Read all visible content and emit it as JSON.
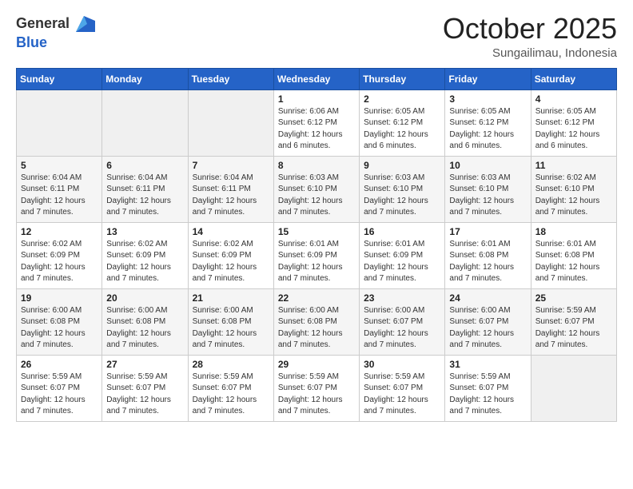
{
  "header": {
    "logo_general": "General",
    "logo_blue": "Blue",
    "month": "October 2025",
    "location": "Sungailimau, Indonesia"
  },
  "days_of_week": [
    "Sunday",
    "Monday",
    "Tuesday",
    "Wednesday",
    "Thursday",
    "Friday",
    "Saturday"
  ],
  "weeks": [
    [
      {
        "day": "",
        "detail": ""
      },
      {
        "day": "",
        "detail": ""
      },
      {
        "day": "",
        "detail": ""
      },
      {
        "day": "1",
        "detail": "Sunrise: 6:06 AM\nSunset: 6:12 PM\nDaylight: 12 hours\nand 6 minutes."
      },
      {
        "day": "2",
        "detail": "Sunrise: 6:05 AM\nSunset: 6:12 PM\nDaylight: 12 hours\nand 6 minutes."
      },
      {
        "day": "3",
        "detail": "Sunrise: 6:05 AM\nSunset: 6:12 PM\nDaylight: 12 hours\nand 6 minutes."
      },
      {
        "day": "4",
        "detail": "Sunrise: 6:05 AM\nSunset: 6:12 PM\nDaylight: 12 hours\nand 6 minutes."
      }
    ],
    [
      {
        "day": "5",
        "detail": "Sunrise: 6:04 AM\nSunset: 6:11 PM\nDaylight: 12 hours\nand 7 minutes."
      },
      {
        "day": "6",
        "detail": "Sunrise: 6:04 AM\nSunset: 6:11 PM\nDaylight: 12 hours\nand 7 minutes."
      },
      {
        "day": "7",
        "detail": "Sunrise: 6:04 AM\nSunset: 6:11 PM\nDaylight: 12 hours\nand 7 minutes."
      },
      {
        "day": "8",
        "detail": "Sunrise: 6:03 AM\nSunset: 6:10 PM\nDaylight: 12 hours\nand 7 minutes."
      },
      {
        "day": "9",
        "detail": "Sunrise: 6:03 AM\nSunset: 6:10 PM\nDaylight: 12 hours\nand 7 minutes."
      },
      {
        "day": "10",
        "detail": "Sunrise: 6:03 AM\nSunset: 6:10 PM\nDaylight: 12 hours\nand 7 minutes."
      },
      {
        "day": "11",
        "detail": "Sunrise: 6:02 AM\nSunset: 6:10 PM\nDaylight: 12 hours\nand 7 minutes."
      }
    ],
    [
      {
        "day": "12",
        "detail": "Sunrise: 6:02 AM\nSunset: 6:09 PM\nDaylight: 12 hours\nand 7 minutes."
      },
      {
        "day": "13",
        "detail": "Sunrise: 6:02 AM\nSunset: 6:09 PM\nDaylight: 12 hours\nand 7 minutes."
      },
      {
        "day": "14",
        "detail": "Sunrise: 6:02 AM\nSunset: 6:09 PM\nDaylight: 12 hours\nand 7 minutes."
      },
      {
        "day": "15",
        "detail": "Sunrise: 6:01 AM\nSunset: 6:09 PM\nDaylight: 12 hours\nand 7 minutes."
      },
      {
        "day": "16",
        "detail": "Sunrise: 6:01 AM\nSunset: 6:09 PM\nDaylight: 12 hours\nand 7 minutes."
      },
      {
        "day": "17",
        "detail": "Sunrise: 6:01 AM\nSunset: 6:08 PM\nDaylight: 12 hours\nand 7 minutes."
      },
      {
        "day": "18",
        "detail": "Sunrise: 6:01 AM\nSunset: 6:08 PM\nDaylight: 12 hours\nand 7 minutes."
      }
    ],
    [
      {
        "day": "19",
        "detail": "Sunrise: 6:00 AM\nSunset: 6:08 PM\nDaylight: 12 hours\nand 7 minutes."
      },
      {
        "day": "20",
        "detail": "Sunrise: 6:00 AM\nSunset: 6:08 PM\nDaylight: 12 hours\nand 7 minutes."
      },
      {
        "day": "21",
        "detail": "Sunrise: 6:00 AM\nSunset: 6:08 PM\nDaylight: 12 hours\nand 7 minutes."
      },
      {
        "day": "22",
        "detail": "Sunrise: 6:00 AM\nSunset: 6:08 PM\nDaylight: 12 hours\nand 7 minutes."
      },
      {
        "day": "23",
        "detail": "Sunrise: 6:00 AM\nSunset: 6:07 PM\nDaylight: 12 hours\nand 7 minutes."
      },
      {
        "day": "24",
        "detail": "Sunrise: 6:00 AM\nSunset: 6:07 PM\nDaylight: 12 hours\nand 7 minutes."
      },
      {
        "day": "25",
        "detail": "Sunrise: 5:59 AM\nSunset: 6:07 PM\nDaylight: 12 hours\nand 7 minutes."
      }
    ],
    [
      {
        "day": "26",
        "detail": "Sunrise: 5:59 AM\nSunset: 6:07 PM\nDaylight: 12 hours\nand 7 minutes."
      },
      {
        "day": "27",
        "detail": "Sunrise: 5:59 AM\nSunset: 6:07 PM\nDaylight: 12 hours\nand 7 minutes."
      },
      {
        "day": "28",
        "detail": "Sunrise: 5:59 AM\nSunset: 6:07 PM\nDaylight: 12 hours\nand 7 minutes."
      },
      {
        "day": "29",
        "detail": "Sunrise: 5:59 AM\nSunset: 6:07 PM\nDaylight: 12 hours\nand 7 minutes."
      },
      {
        "day": "30",
        "detail": "Sunrise: 5:59 AM\nSunset: 6:07 PM\nDaylight: 12 hours\nand 7 minutes."
      },
      {
        "day": "31",
        "detail": "Sunrise: 5:59 AM\nSunset: 6:07 PM\nDaylight: 12 hours\nand 7 minutes."
      },
      {
        "day": "",
        "detail": ""
      }
    ]
  ]
}
